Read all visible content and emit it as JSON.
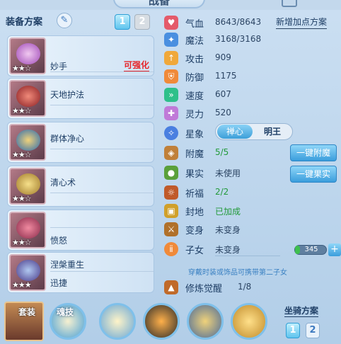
{
  "window": {
    "title": "战备"
  },
  "equipment": {
    "header": "装备方案",
    "plan_buttons": [
      "1",
      "2"
    ],
    "items": [
      {
        "name": "妙手",
        "tag": "可强化",
        "stars": "★★☆",
        "gem": "purple-ring-icon"
      },
      {
        "name": "天地护法",
        "stars": "★★☆",
        "gem": "red-fan-icon"
      },
      {
        "name": "群体净心",
        "stars": "★★☆",
        "gem": "demon-mask-icon"
      },
      {
        "name": "清心术",
        "stars": "★★☆",
        "gem": "golden-chain-icon"
      },
      {
        "name": "愤怒",
        "stars": "★★☆",
        "gem": "red-belt-icon"
      },
      {
        "name": "涅槃重生",
        "sub": "迅捷",
        "stars": "★★★",
        "gem": "warrior-icon"
      }
    ]
  },
  "stats": {
    "add_plan": "新增加点方案",
    "rows": [
      {
        "label": "气血",
        "value": "8643/8643",
        "icon": "heart-icon",
        "color": "#e45a6a"
      },
      {
        "label": "魔法",
        "value": "3168/3168",
        "icon": "magic-icon",
        "color": "#4a8fe0"
      },
      {
        "label": "攻击",
        "value": "909",
        "icon": "attack-icon",
        "color": "#f0a83a"
      },
      {
        "label": "防御",
        "value": "1175",
        "icon": "shield-icon",
        "color": "#f08a3a"
      },
      {
        "label": "速度",
        "value": "607",
        "icon": "speed-icon",
        "color": "#2ec08a"
      },
      {
        "label": "灵力",
        "value": "520",
        "icon": "spirit-icon",
        "color": "#c07ad8"
      }
    ],
    "star": {
      "label": "星象",
      "options": [
        "禅心",
        "明王"
      ]
    }
  },
  "extras": {
    "rows": [
      {
        "label": "附魔",
        "value": "5/5",
        "green": true,
        "icon": "enchant-icon"
      },
      {
        "label": "果实",
        "value": "未使用",
        "green": false,
        "icon": "fruit-icon"
      },
      {
        "label": "祈福",
        "value": "2/2",
        "green": true,
        "icon": "bless-icon"
      },
      {
        "label": "封地",
        "value": "已加成",
        "green": true,
        "icon": "land-icon"
      },
      {
        "label": "变身",
        "value": "未变身",
        "green": false,
        "icon": "transform-icon"
      },
      {
        "label": "子女",
        "value": "未变身",
        "green": false,
        "icon": "child-icon"
      }
    ],
    "enchant_button": "一键附魔",
    "fruit_button": "一键果实",
    "child_bar_value": "345",
    "child_bar_fraction": 0.15,
    "note": "穿戴时装或饰品可携带第二子女",
    "awaken": {
      "label": "修炼觉醒",
      "value": "1/8",
      "icon": "awaken-icon"
    }
  },
  "bottom": {
    "set_label": "套装",
    "skill_label": "魂技",
    "mount_title": "坐骑方案",
    "mount_buttons": [
      "1",
      "2"
    ]
  }
}
